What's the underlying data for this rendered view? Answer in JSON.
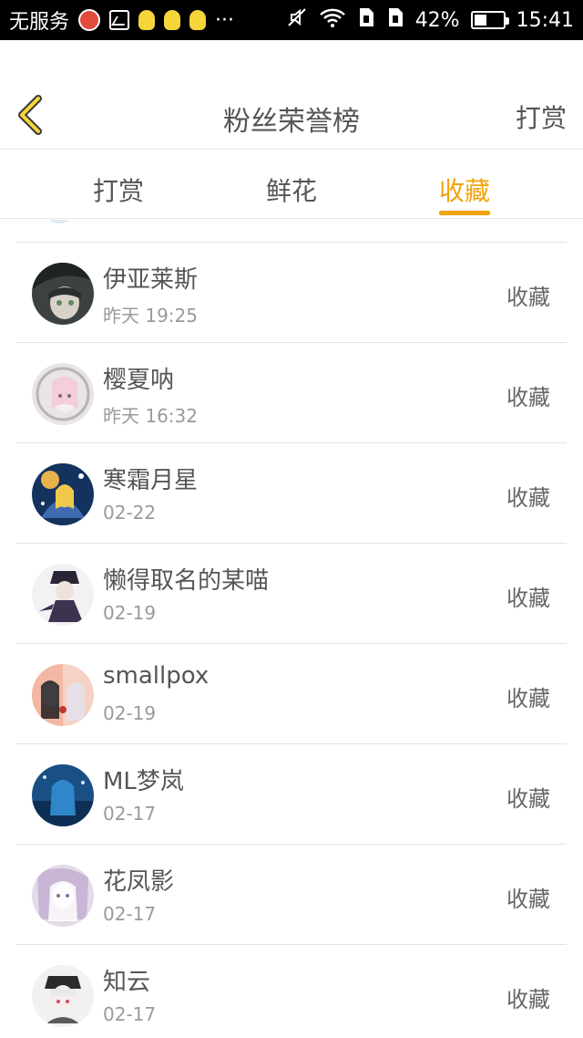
{
  "status_bar": {
    "carrier": "无服务",
    "battery_percent": "42%",
    "battery_level": 0.42,
    "time": "15:41",
    "icons": [
      "app-icon",
      "gallery-icon",
      "bulb-icon",
      "bulb-icon",
      "bulb-icon",
      "more-icon",
      "mute-icon",
      "wifi-icon",
      "sim-icon",
      "sim-icon",
      "battery-icon"
    ]
  },
  "header": {
    "title": "粉丝荣誉榜",
    "action_label": "打赏",
    "back_icon": "chevron-left-icon"
  },
  "tabs": [
    {
      "label": "打赏",
      "active": false
    },
    {
      "label": "鲜花",
      "active": false
    },
    {
      "label": "收藏",
      "active": true
    }
  ],
  "accent_color": "#f0a30a",
  "list": [
    {
      "name": "伊亚莱斯",
      "time": "昨天 19:25",
      "action": "收藏"
    },
    {
      "name": "樱夏呐",
      "time": "昨天 16:32",
      "action": "收藏"
    },
    {
      "name": "寒霜月星",
      "time": "02-22",
      "action": "收藏"
    },
    {
      "name": "懒得取名的某喵",
      "time": "02-19",
      "action": "收藏"
    },
    {
      "name": "smallpox",
      "time": "02-19",
      "action": "收藏"
    },
    {
      "name": "ML梦岚",
      "time": "02-17",
      "action": "收藏"
    },
    {
      "name": "花凤影",
      "time": "02-17",
      "action": "收藏"
    },
    {
      "name": "知云",
      "time": "02-17",
      "action": "收藏"
    }
  ]
}
